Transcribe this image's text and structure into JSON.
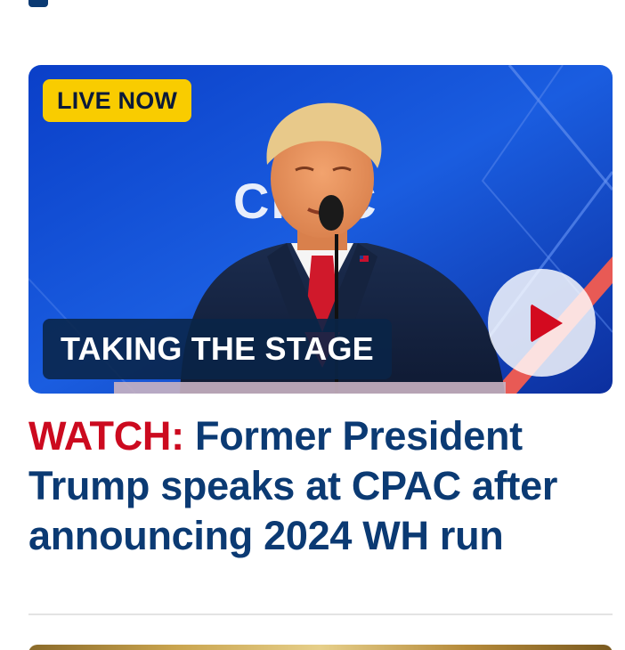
{
  "featured_video": {
    "live_badge": "LIVE NOW",
    "banner": "TAKING THE STAGE",
    "play_icon": "play-icon",
    "colors": {
      "badge_bg": "#f9cc00",
      "banner_bg": "#092448",
      "play_icon": "#d30a1f"
    }
  },
  "headline": {
    "kicker": "WATCH:",
    "text": "Former President Trump speaks at CPAC after announcing 2024 WH run",
    "colors": {
      "kicker": "#cc0a1f",
      "text": "#0b3a73"
    }
  }
}
